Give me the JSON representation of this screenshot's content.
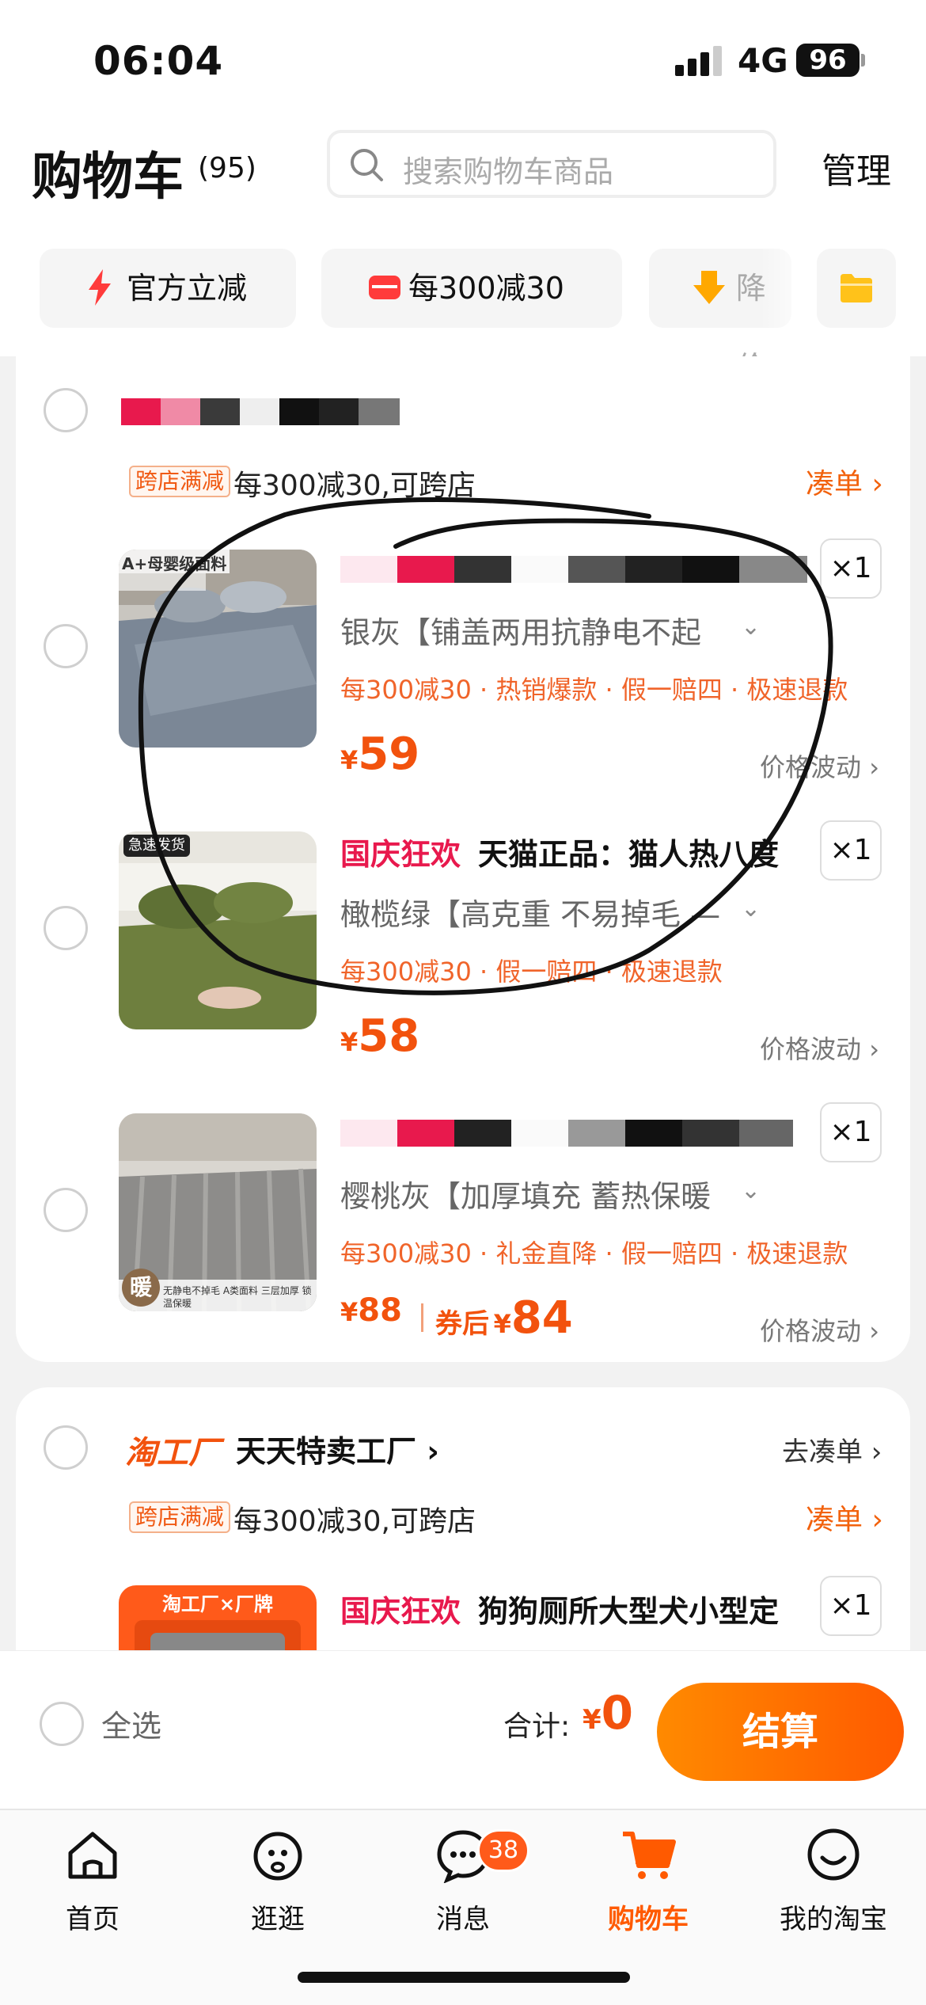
{
  "status_bar": {
    "time": "06:04",
    "network": "4G",
    "battery": "96"
  },
  "header": {
    "title": "购物车",
    "count": "(95)",
    "search_placeholder": "搜索购物车商品",
    "manage": "管理"
  },
  "filter_chips": [
    {
      "label": "官方立减",
      "icon": "lightning-icon"
    },
    {
      "label": "每300减30",
      "icon": "coupon-icon"
    },
    {
      "label": "降价",
      "icon": "price-drop-icon"
    }
  ],
  "store1": {
    "promo_tag": "跨店满减",
    "promo_text": "每300减30,可跨店",
    "promo_link": "凑单",
    "products": [
      {
        "image_overlay": "A+母婴级面料",
        "sku": "银灰【铺盖两用抗静电不起",
        "tags": "每300减30 · 热销爆款 · 假一赔四 · 极速退款",
        "price_currency": "¥",
        "price": "59",
        "quantity": "×1",
        "price_wave": "价格波动"
      },
      {
        "image_badge": "急速发货",
        "title_red": "国庆狂欢",
        "title": "天猫正品：猫人热八度",
        "sku": "橄榄绿【高克重 不易掉毛 —",
        "tags": "每300减30 · 假一赔四 · 极速退款",
        "price_currency": "¥",
        "price": "58",
        "quantity": "×1",
        "price_wave": "价格波动"
      },
      {
        "image_overlay": "暖",
        "image_caption": "无静电不掉毛 A类面料 三层加厚 锁温保暖",
        "sku": "樱桃灰【加厚填充 蓄热保暖",
        "tags": "每300减30 · 礼金直降 · 假一赔四 · 极速退款",
        "price_currency": "¥",
        "price": "88",
        "coupon_label": "券后",
        "coupon_price_currency": "¥",
        "coupon_price": "84",
        "quantity": "×1",
        "price_wave": "价格波动"
      }
    ]
  },
  "store2": {
    "brand": "淘工厂",
    "name": "天天特卖工厂",
    "link": "去凑单",
    "promo_tag": "跨店满减",
    "promo_text": "每300减30,可跨店",
    "promo_link": "凑单",
    "product": {
      "image_banner": "淘工厂×厂牌",
      "title_red": "国庆狂欢",
      "title": "狗狗厕所大型犬小型定",
      "quantity": "×1"
    }
  },
  "settle": {
    "select_all": "全选",
    "total_label": "合计:",
    "total_currency": "¥",
    "total": "0",
    "checkout": "结算"
  },
  "tabbar": [
    {
      "label": "首页",
      "icon": "home-icon"
    },
    {
      "label": "逛逛",
      "icon": "stroll-icon"
    },
    {
      "label": "消息",
      "icon": "message-icon",
      "badge": "38"
    },
    {
      "label": "购物车",
      "icon": "cart-icon",
      "active": true
    },
    {
      "label": "我的淘宝",
      "icon": "profile-icon"
    }
  ],
  "colors": {
    "accent": "#f2620d",
    "price": "#f2520d",
    "promo_red": "#e8194d"
  }
}
